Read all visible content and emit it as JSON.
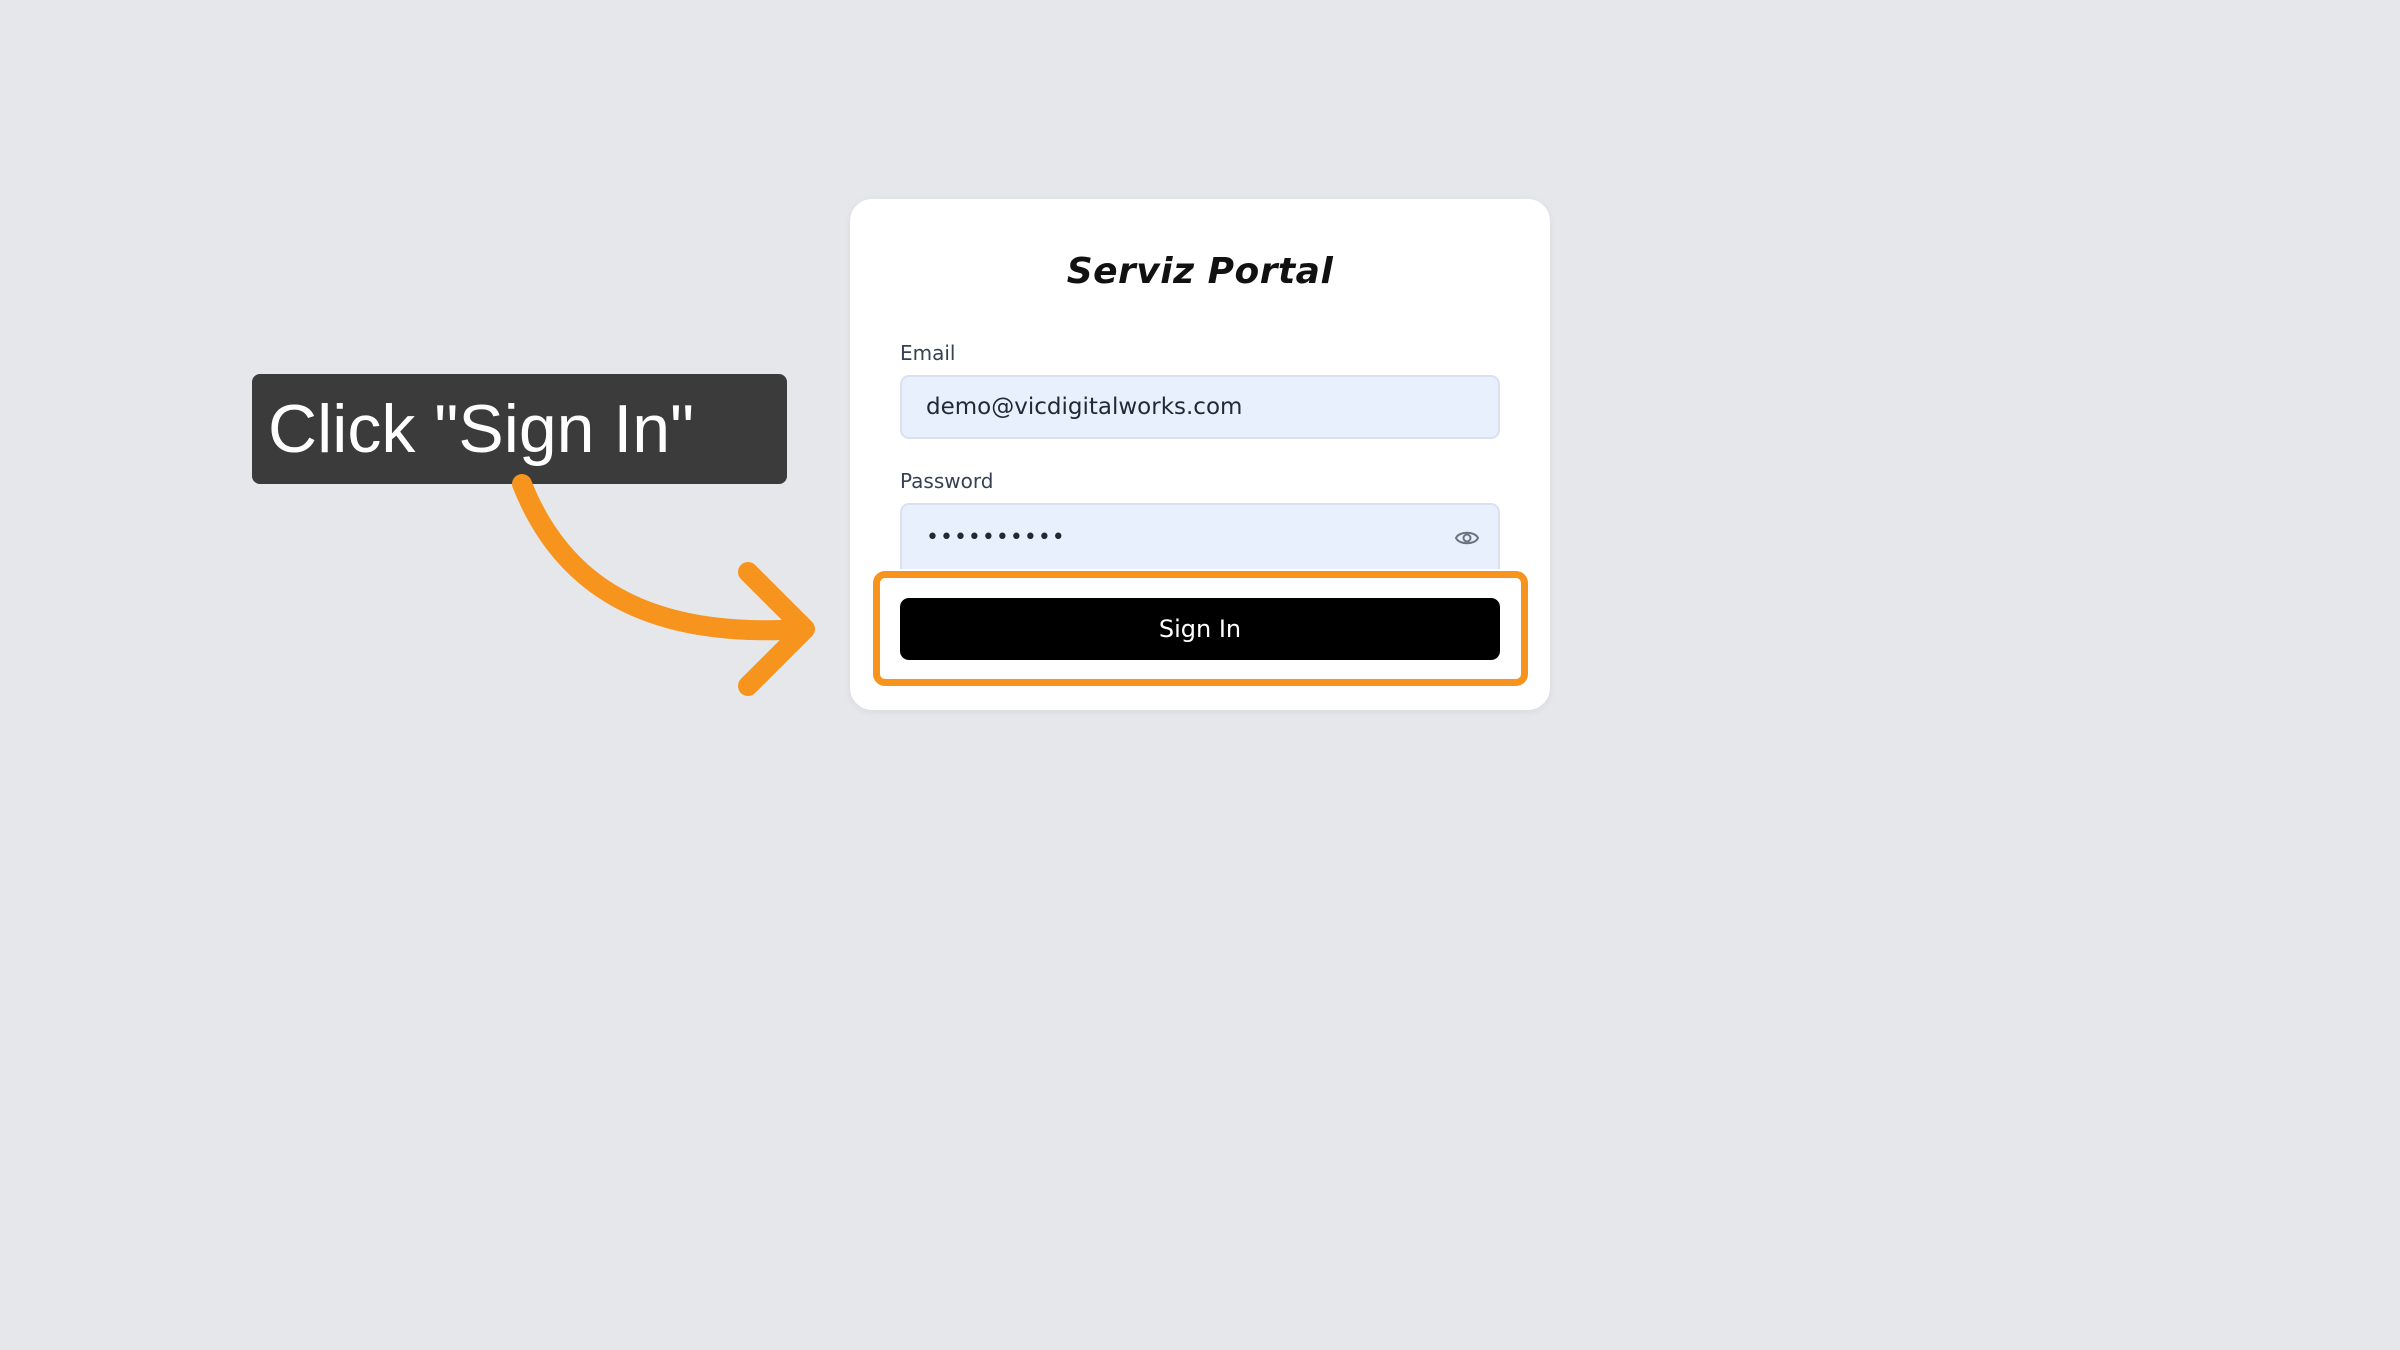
{
  "app": {
    "title": "Serviz Portal"
  },
  "form": {
    "email_label": "Email",
    "email_value": "demo@vicdigitalworks.com",
    "password_label": "Password",
    "password_value": "••••••••••",
    "submit_label": "Sign In"
  },
  "annotation": {
    "callout_text": "Click \"Sign In\"",
    "accent_color": "#f7941d"
  },
  "icons": {
    "password_toggle": "eye-icon"
  },
  "colors": {
    "background": "#e5e7eb",
    "card": "#ffffff",
    "input_bg": "#e8effd",
    "button_bg": "#000000",
    "callout_bg": "#3b3b3b"
  }
}
